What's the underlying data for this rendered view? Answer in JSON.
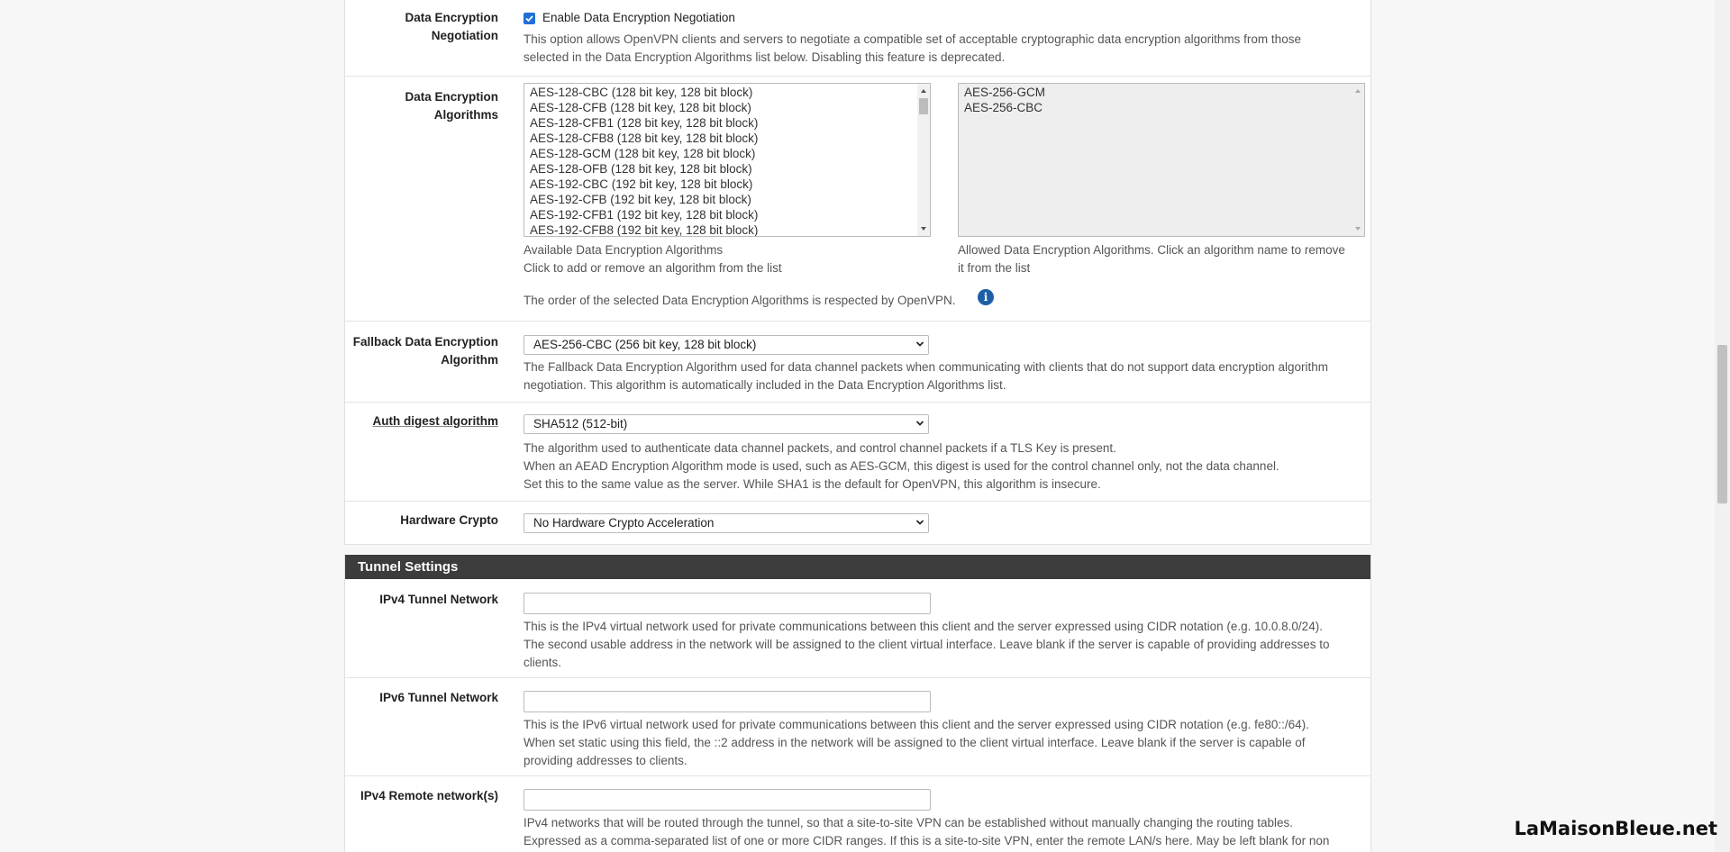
{
  "encryption_negotiation": {
    "label_line1": "Data Encryption",
    "label_line2": "Negotiation",
    "checkbox_label": "Enable Data Encryption Negotiation",
    "checked": true,
    "help_line1": "This option allows OpenVPN clients and servers to negotiate a compatible set of acceptable cryptographic data encryption algorithms from those",
    "help_line2": "selected in the Data Encryption Algorithms list below. Disabling this feature is deprecated."
  },
  "encryption_algorithms": {
    "label_line1": "Data Encryption",
    "label_line2": "Algorithms",
    "available": [
      "AES-128-CBC (128 bit key, 128 bit block)",
      "AES-128-CFB (128 bit key, 128 bit block)",
      "AES-128-CFB1 (128 bit key, 128 bit block)",
      "AES-128-CFB8 (128 bit key, 128 bit block)",
      "AES-128-GCM (128 bit key, 128 bit block)",
      "AES-128-OFB (128 bit key, 128 bit block)",
      "AES-192-CBC (192 bit key, 128 bit block)",
      "AES-192-CFB (192 bit key, 128 bit block)",
      "AES-192-CFB1 (192 bit key, 128 bit block)",
      "AES-192-CFB8 (192 bit key, 128 bit block)"
    ],
    "allowed": [
      "AES-256-GCM",
      "AES-256-CBC"
    ],
    "available_help_line1": "Available Data Encryption Algorithms",
    "available_help_line2": "Click to add or remove an algorithm from the list",
    "allowed_help_line1": "Allowed Data Encryption Algorithms. Click an algorithm name to remove",
    "allowed_help_line2": "it from the list",
    "order_note": "The order of the selected Data Encryption Algorithms is respected by OpenVPN."
  },
  "fallback": {
    "label_line1": "Fallback Data Encryption",
    "label_line2": "Algorithm",
    "selected": "AES-256-CBC (256 bit key, 128 bit block)",
    "help_line1": "The Fallback Data Encryption Algorithm used for data channel packets when communicating with clients that do not support data encryption algorithm",
    "help_line2": "negotiation. This algorithm is automatically included in the Data Encryption Algorithms list."
  },
  "auth_digest": {
    "label": "Auth digest algorithm",
    "selected": "SHA512 (512-bit)",
    "help_line1": "The algorithm used to authenticate data channel packets, and control channel packets if a TLS Key is present.",
    "help_line2": "When an AEAD Encryption Algorithm mode is used, such as AES-GCM, this digest is used for the control channel only, not the data channel.",
    "help_line3": "Set this to the same value as the server. While SHA1 is the default for OpenVPN, this algorithm is insecure."
  },
  "hardware_crypto": {
    "label": "Hardware Crypto",
    "selected": "No Hardware Crypto Acceleration"
  },
  "tunnel_settings": {
    "title": "Tunnel Settings",
    "ipv4_tunnel": {
      "label": "IPv4 Tunnel Network",
      "value": "",
      "help_line1": "This is the IPv4 virtual network used for private communications between this client and the server expressed using CIDR notation (e.g. 10.0.8.0/24).",
      "help_line2": "The second usable address in the network will be assigned to the client virtual interface. Leave blank if the server is capable of providing addresses to",
      "help_line3": "clients."
    },
    "ipv6_tunnel": {
      "label": "IPv6 Tunnel Network",
      "value": "",
      "help_line1": "This is the IPv6 virtual network used for private communications between this client and the server expressed using CIDR notation (e.g. fe80::/64).",
      "help_line2": "When set static using this field, the ::2 address in the network will be assigned to the client virtual interface. Leave blank if the server is capable of",
      "help_line3": "providing addresses to clients."
    },
    "ipv4_remote": {
      "label": "IPv4 Remote network(s)",
      "value": "",
      "help_line1": "IPv4 networks that will be routed through the tunnel, so that a site-to-site VPN can be established without manually changing the routing tables.",
      "help_line2": "Expressed as a comma-separated list of one or more CIDR ranges. If this is a site-to-site VPN, enter the remote LAN/s here. May be left blank for non"
    }
  },
  "icons": {
    "info": "info-icon",
    "check": "check-icon",
    "chevron": "chevron-down-icon"
  },
  "watermark": "LaMaisonBleue.net",
  "colors": {
    "accent": "#1f6fd6",
    "section_bg": "#3c3c3c",
    "info": "#1e5fa8"
  }
}
